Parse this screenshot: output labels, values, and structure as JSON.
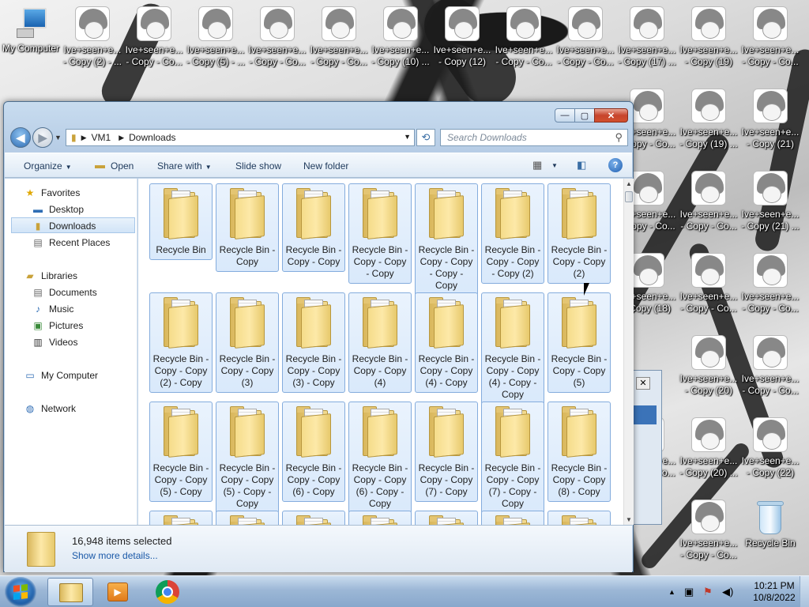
{
  "desktop": {
    "top_icons": [
      {
        "label1": "My Computer",
        "label2": ""
      },
      {
        "label1": "Ive+seen+e...",
        "label2": "- Copy (2) - ..."
      },
      {
        "label1": "Ive+seen+e...",
        "label2": "- Copy - Co..."
      },
      {
        "label1": "Ive+seen+e...",
        "label2": "- Copy (5) - ..."
      },
      {
        "label1": "Ive+seen+e...",
        "label2": "- Copy - Co..."
      },
      {
        "label1": "Ive+seen+e...",
        "label2": "- Copy - Co..."
      },
      {
        "label1": "Ive+seen+e...",
        "label2": "- Copy (10) ..."
      },
      {
        "label1": "Ive+seen+e...",
        "label2": "- Copy (12)"
      },
      {
        "label1": "Ive+seen+e...",
        "label2": "- Copy - Co..."
      },
      {
        "label1": "Ive+seen+e...",
        "label2": "- Copy - Co..."
      },
      {
        "label1": "Ive+seen+e...",
        "label2": "- Copy (17) ..."
      },
      {
        "label1": "Ive+seen+e...",
        "label2": "- Copy (19)"
      },
      {
        "label1": "Ive+seen+e...",
        "label2": "- Copy - Co..."
      }
    ],
    "right_icons": [
      {
        "label1": "Ive+seen+e...",
        "label2": "- Copy - Co..."
      },
      {
        "label1": "Ive+seen+e...",
        "label2": "- Copy (19) ..."
      },
      {
        "label1": "Ive+seen+e...",
        "label2": "- Copy (21)"
      },
      {
        "label1": "Ive+seen+e...",
        "label2": "- Copy - Co..."
      },
      {
        "label1": "Ive+seen+e...",
        "label2": "- Copy - Co..."
      },
      {
        "label1": "Ive+seen+e...",
        "label2": "- Copy (21) ..."
      },
      {
        "label1": "Ive+seen+e...",
        "label2": "- Copy (18)"
      },
      {
        "label1": "Ive+seen+e...",
        "label2": "- Copy - Co..."
      },
      {
        "label1": "Ive+seen+e...",
        "label2": "- Copy - Co..."
      },
      {
        "label1": "Ive+seen+e...",
        "label2": "- Copy (20)"
      },
      {
        "label1": "Ive+seen+e...",
        "label2": "- Copy - Co..."
      },
      {
        "label1": "Ive+seen+e...",
        "label2": "- Copy - Co..."
      },
      {
        "label1": "Ive+seen+e...",
        "label2": "- Copy (20) ..."
      },
      {
        "label1": "Ive+seen+e...",
        "label2": "- Copy (22)"
      },
      {
        "label1": "Ive+seen+e...",
        "label2": "- Copy - Co..."
      },
      {
        "label1": "Recycle Bin",
        "label2": ""
      }
    ]
  },
  "explorer": {
    "caption": {
      "minimize": "—",
      "maximize": "▢",
      "close": "✕"
    },
    "breadcrumb": [
      "VM1",
      "Downloads"
    ],
    "search_placeholder": "Search Downloads",
    "toolbar": {
      "organize": "Organize",
      "open": "Open",
      "share_with": "Share with",
      "slide_show": "Slide show",
      "new_folder": "New folder",
      "help": "?"
    },
    "nav": {
      "favorites": "Favorites",
      "desktop": "Desktop",
      "downloads": "Downloads",
      "recent_places": "Recent Places",
      "libraries": "Libraries",
      "documents": "Documents",
      "music": "Music",
      "pictures": "Pictures",
      "videos": "Videos",
      "my_computer": "My Computer",
      "network": "Network"
    },
    "folders": [
      "Recycle Bin",
      "Recycle Bin - Copy",
      "Recycle Bin - Copy - Copy",
      "Recycle Bin - Copy - Copy - Copy",
      "Recycle Bin - Copy - Copy - Copy - Copy",
      "Recycle Bin - Copy - Copy - Copy (2)",
      "Recycle Bin - Copy - Copy (2)",
      "Recycle Bin - Copy - Copy (2) - Copy",
      "Recycle Bin - Copy - Copy (3)",
      "Recycle Bin - Copy - Copy (3) - Copy",
      "Recycle Bin - Copy - Copy (4)",
      "Recycle Bin - Copy - Copy (4) - Copy",
      "Recycle Bin - Copy - Copy (4) - Copy - Copy",
      "Recycle Bin - Copy - Copy (5)",
      "Recycle Bin - Copy - Copy (5) - Copy",
      "Recycle Bin - Copy - Copy (5) - Copy - Copy",
      "Recycle Bin - Copy - Copy (6) - Copy",
      "Recycle Bin - Copy - Copy (6) - Copy - Copy",
      "Recycle Bin - Copy - Copy (7) - Copy",
      "Recycle Bin - Copy - Copy (7) - Copy - Copy",
      "Recycle Bin - Copy - Copy (8) - Copy"
    ],
    "status": {
      "count": "16,948 items selected",
      "more": "Show more details..."
    }
  },
  "taskbar": {
    "time": "10:21 PM",
    "date": "10/8/2022"
  }
}
